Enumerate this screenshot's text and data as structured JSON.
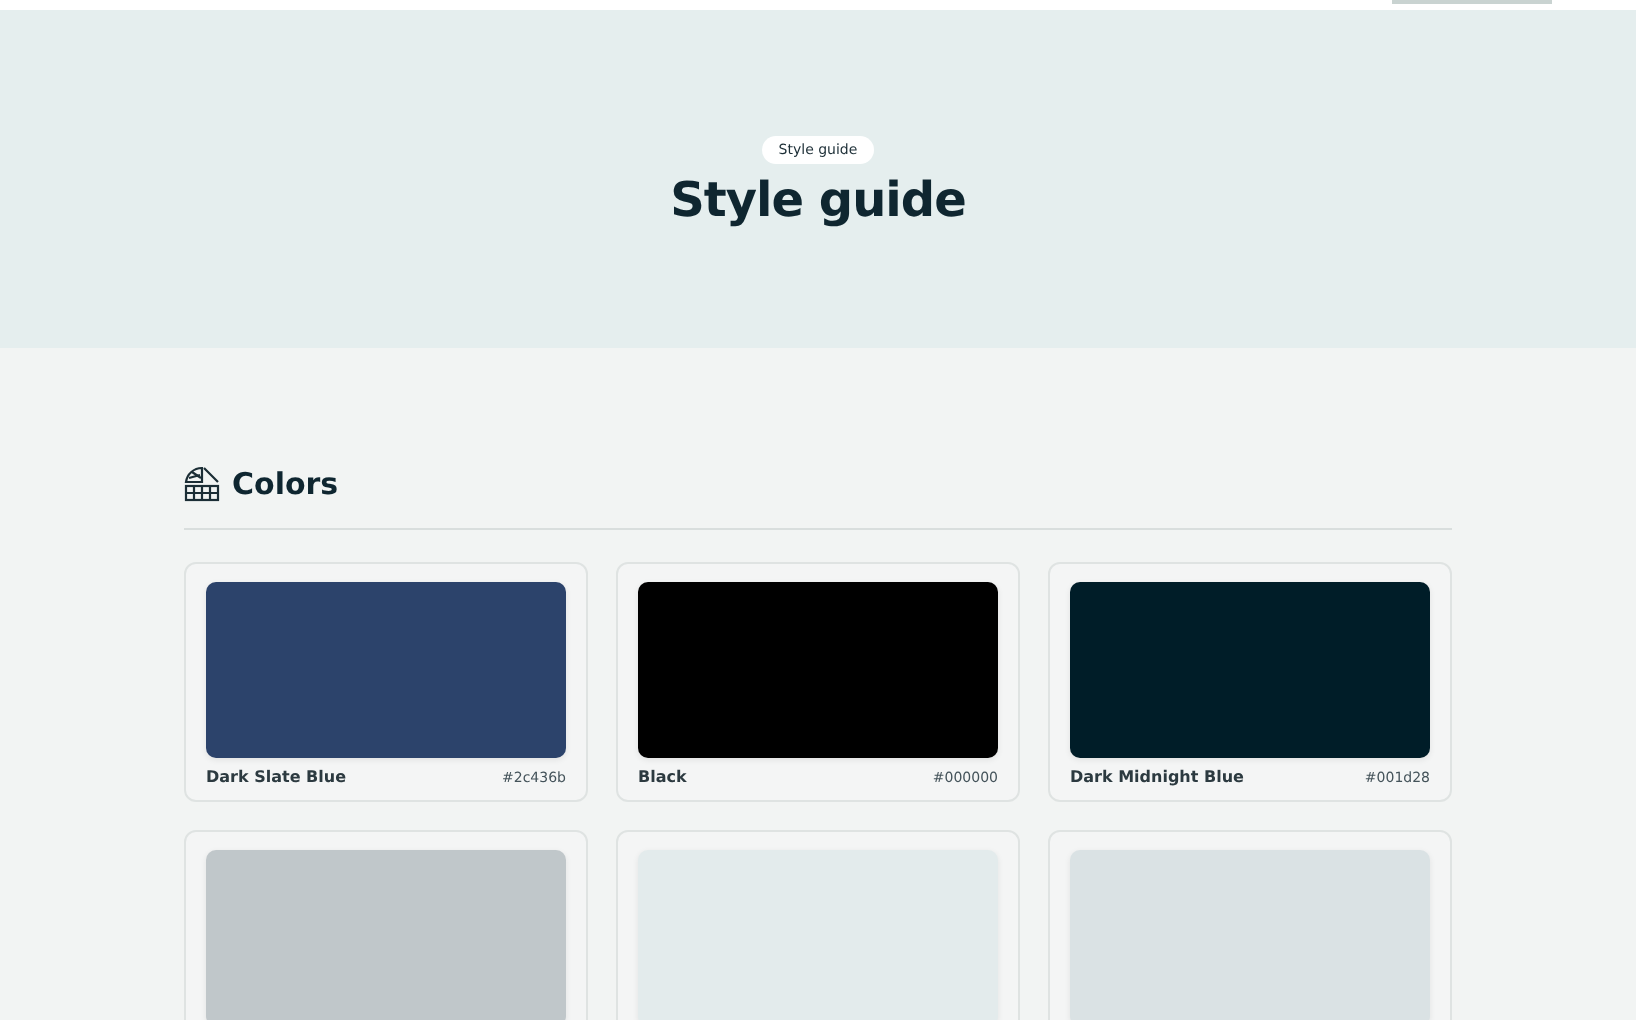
{
  "hero": {
    "badge": "Style guide",
    "title": "Style guide"
  },
  "colors_section": {
    "heading": "Colors",
    "swatches": [
      {
        "name": "Dark Slate Blue",
        "hex": "#2c436b",
        "color": "#2c436b"
      },
      {
        "name": "Black",
        "hex": "#000000",
        "color": "#000000"
      },
      {
        "name": "Dark Midnight Blue",
        "hex": "#001d28",
        "color": "#001d28"
      },
      {
        "color": "#c0c7ca"
      },
      {
        "color": "#e3ebec"
      },
      {
        "color": "#dae2e4"
      }
    ]
  }
}
